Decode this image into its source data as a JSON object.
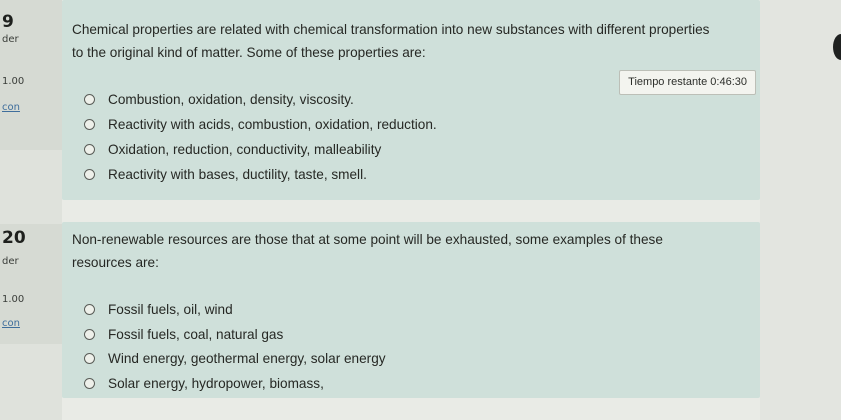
{
  "questions": [
    {
      "number": "9",
      "side_label": "der",
      "score": "1.00",
      "link": "con",
      "text": "Chemical properties are related with chemical transformation into new substances with different properties to the original kind of matter. Some of these properties are:",
      "timer": "Tiempo restante 0:46:30",
      "options": [
        "Combustion, oxidation, density, viscosity.",
        "Reactivity with acids, combustion, oxidation, reduction.",
        "Oxidation, reduction, conductivity, malleability",
        "Reactivity with bases, ductility, taste, smell."
      ]
    },
    {
      "number": "20",
      "side_label": "der",
      "score": "1.00",
      "link": "con",
      "text": "Non-renewable resources are those that at some point will be exhausted, some examples of these resources are:",
      "options": [
        "Fossil fuels, oil, wind",
        "Fossil fuels, coal, natural gas",
        "Wind energy, geothermal energy, solar energy",
        "Solar energy, hydropower, biomass,"
      ]
    }
  ]
}
